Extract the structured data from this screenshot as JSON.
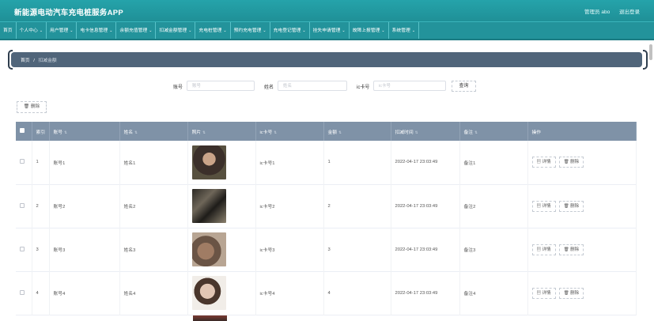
{
  "app": {
    "title": "新能源电动汽车充电桩服务APP",
    "user_label": "管理员 abo",
    "logout": "退出登录"
  },
  "nav": {
    "items": [
      {
        "label": "首页",
        "has_menu": false
      },
      {
        "label": "个人中心",
        "has_menu": true
      },
      {
        "label": "用户管理",
        "has_menu": true
      },
      {
        "label": "电卡信息管理",
        "has_menu": true
      },
      {
        "label": "余额充值管理",
        "has_menu": true
      },
      {
        "label": "扣减金额管理",
        "has_menu": true
      },
      {
        "label": "充电桩管理",
        "has_menu": true
      },
      {
        "label": "预约充电管理",
        "has_menu": true
      },
      {
        "label": "充电登记管理",
        "has_menu": true
      },
      {
        "label": "挂失申请管理",
        "has_menu": true
      },
      {
        "label": "故障上报管理",
        "has_menu": true
      },
      {
        "label": "系统管理",
        "has_menu": true
      }
    ],
    "chevron": "⌄"
  },
  "breadcrumb": {
    "home": "首页",
    "sep": "/",
    "current": "扣减金额"
  },
  "search": {
    "account_label": "账号",
    "account_placeholder": "账号",
    "name_label": "姓名",
    "name_placeholder": "姓名",
    "card_label": "ic卡号",
    "card_placeholder": "ic卡号",
    "button": "查询"
  },
  "toolbar": {
    "delete_label": "删除",
    "trash_icon": "🗑"
  },
  "table": {
    "columns": [
      "索引",
      "账号",
      "姓名",
      "照片",
      "ic卡号",
      "金额",
      "扣减时间",
      "备注",
      "操作"
    ],
    "sort_icon": "⇅",
    "detail_icon": "▤",
    "detail_label": "详情",
    "delete_icon": "🗑",
    "delete_label": "删除",
    "rows": [
      {
        "index": "1",
        "account": "账号1",
        "name": "姓名1",
        "card": "ic卡号1",
        "amount": "1",
        "time": "2022-04-17 23:03:49",
        "remark": "备注1"
      },
      {
        "index": "2",
        "account": "账号2",
        "name": "姓名2",
        "card": "ic卡号2",
        "amount": "2",
        "time": "2022-04-17 23:03:49",
        "remark": "备注2"
      },
      {
        "index": "3",
        "account": "账号3",
        "name": "姓名3",
        "card": "ic卡号3",
        "amount": "3",
        "time": "2022-04-17 23:03:49",
        "remark": "备注3"
      },
      {
        "index": "4",
        "account": "账号4",
        "name": "姓名4",
        "card": "ic卡号4",
        "amount": "4",
        "time": "2022-04-17 23:03:49",
        "remark": "备注4"
      }
    ]
  },
  "colors": {
    "header": "#23939b",
    "breadcrumb": "#50657a",
    "table_head": "#7f92a7"
  }
}
